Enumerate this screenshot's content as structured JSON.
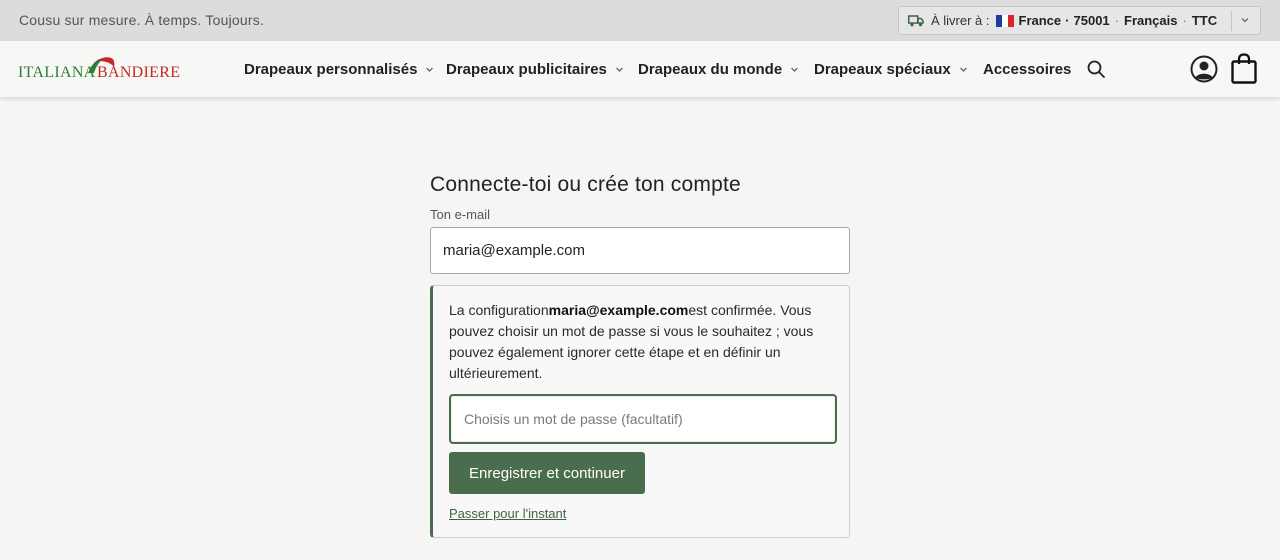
{
  "topbar": {
    "tagline": "Cousu sur mesure. À temps. Toujours.",
    "delivery": {
      "label": "À livrer à :",
      "country": "France",
      "postcode": "75001",
      "language": "Français",
      "tax": "TTC",
      "separator": "·",
      "flag_colors": [
        "#1f3b9c",
        "#ffffff",
        "#d7262e"
      ]
    }
  },
  "header": {
    "logo": {
      "part1": "ITALIANA",
      "part2": "BANDIERE"
    },
    "nav": [
      {
        "label": "Drapeaux personnalisés",
        "has_dropdown": true
      },
      {
        "label": "Drapeaux publicitaires",
        "has_dropdown": true
      },
      {
        "label": "Drapeaux du monde",
        "has_dropdown": true
      },
      {
        "label": "Drapeaux spéciaux",
        "has_dropdown": true
      },
      {
        "label": "Accessoires",
        "has_dropdown": false
      }
    ],
    "icons": [
      "search-icon",
      "account-icon",
      "shopping-bag-icon"
    ]
  },
  "main": {
    "title": "Connecte-toi ou crée ton compte",
    "email_label": "Ton e-mail",
    "email_value": "maria@example.com",
    "message_prefix": "La configuration",
    "message_email": "maria@example.com",
    "message_suffix": "est confirmée. Vous pouvez choisir un mot de passe si vous le souhaitez ; vous pouvez également ignorer cette étape et en définir un ultérieurement.",
    "password_placeholder": "Choisis un mot de passe (facultatif)",
    "password_value": "",
    "save_button": "Enregistrer et continuer",
    "skip_link": "Passer pour l'instant"
  },
  "colors": {
    "accent": "#4a6e4d",
    "topbar_bg": "#dcdcdc",
    "page_bg": "#f5f5f4"
  }
}
